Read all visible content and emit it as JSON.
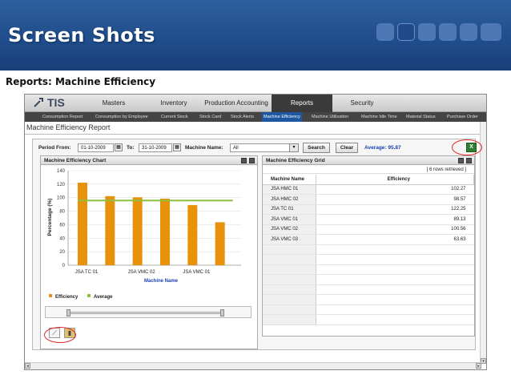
{
  "slide": {
    "title": "Screen Shots",
    "subtitle": "Reports: Machine Efficiency"
  },
  "app": {
    "logo": "TIS",
    "nav": [
      {
        "label": "Masters"
      },
      {
        "label": "Inventory"
      },
      {
        "label": "Production Accounting"
      },
      {
        "label": "Reports",
        "active": true
      },
      {
        "label": "Security"
      }
    ],
    "subnav": [
      {
        "label": "Consumption Report"
      },
      {
        "label": "Consumption by Employee"
      },
      {
        "label": "Current Stock"
      },
      {
        "label": "Stock Card"
      },
      {
        "label": "Stock Alerts"
      },
      {
        "label": "Machine Efficiency",
        "active": true
      },
      {
        "label": "Machine Utilization"
      },
      {
        "label": "Machine Idle Time"
      },
      {
        "label": "Material Status"
      },
      {
        "label": "Purchase Order"
      }
    ],
    "page_title": "Machine Efficiency Report"
  },
  "filter": {
    "period_from_label": "Period From:",
    "period_from": "01-10-2009",
    "to_label": "To:",
    "to": "31-10-2009",
    "machine_name_label": "Machine Name:",
    "machine_name": "All",
    "search_label": "Search",
    "clear_label": "Clear",
    "average_label": "Average: 95.87",
    "export_icon": "excel-export-icon"
  },
  "chart_panel": {
    "title": "Machine Efficiency Chart"
  },
  "grid_panel": {
    "title": "Machine Efficiency Grid",
    "status": "[ 6 rows retrieved ]",
    "headers": [
      "Machine Name",
      "Efficiency"
    ],
    "rows": [
      [
        "JSA HMC 01",
        "102.27"
      ],
      [
        "JSA HMC 02",
        "98.57"
      ],
      [
        "JSA TC 01",
        "122.25"
      ],
      [
        "JSA VMC 01",
        "89.13"
      ],
      [
        "JSA VMC 02",
        "100.56"
      ],
      [
        "JSA VMC 03",
        "63.63"
      ]
    ]
  },
  "chart_data": {
    "type": "bar",
    "categories": [
      "JSA TC 01",
      "JSA HMC 01",
      "JSA VMC 02",
      "JSA HMC 02",
      "JSA VMC 01",
      "JSA VMC 03"
    ],
    "category_labels_shown": [
      "JSA TC 01",
      "JSA VMC 02",
      "JSA VMC 01"
    ],
    "series": [
      {
        "name": "Efficiency",
        "values": [
          122.25,
          102.27,
          100.56,
          98.57,
          89.13,
          63.63
        ],
        "color": "#e8920c"
      },
      {
        "name": "Average",
        "value": 95.87,
        "color": "#8fbf3f"
      }
    ],
    "ylabel": "Percentage (%)",
    "xlabel": "Machine Name",
    "ylim": [
      0,
      140
    ],
    "yticks": [
      0,
      20,
      40,
      60,
      80,
      100,
      120,
      140
    ],
    "legend": "bottom-left"
  },
  "colors": {
    "banner": "#1f4c8a",
    "bar": "#e8920c",
    "average_line": "#8fbf3f",
    "active_nav": "#3a3a3a",
    "active_subnav": "#1e56a0",
    "highlight_oval": "#e02020"
  }
}
